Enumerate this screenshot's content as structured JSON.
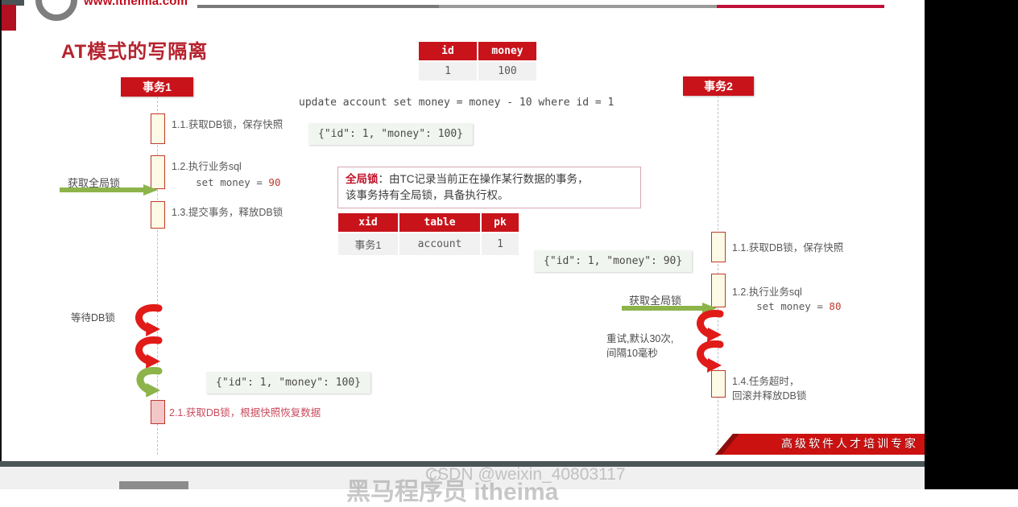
{
  "header": {
    "site_url": "www.itheima.com",
    "logo_name": "itheima-ring-logo"
  },
  "slide": {
    "title": "AT模式的写隔离",
    "sql_statement": "update account set money = money - 10 where id = 1"
  },
  "account_table": {
    "headers": [
      "id",
      "money"
    ],
    "rows": [
      [
        "1",
        "100"
      ]
    ]
  },
  "lock_table": {
    "headers": [
      "xid",
      "table",
      "pk"
    ],
    "rows": [
      [
        "事务1",
        "account",
        "1"
      ]
    ]
  },
  "note": {
    "term": "全局锁",
    "line1": "：由TC记录当前正在操作某行数据的事务，",
    "line2": "该事务持有全局锁，具备执行权。"
  },
  "tx1": {
    "actor_label": "事务1",
    "global_lock_arrow_label": "获取全局锁",
    "wait_db_lock_label": "等待DB锁",
    "steps": [
      {
        "id": "1.1",
        "text": "1.1.获取DB锁，保存快照"
      },
      {
        "id": "1.2",
        "text": "1.2.执行业务sql",
        "sub": "    set money = ",
        "sub_value": "90"
      },
      {
        "id": "1.3",
        "text": "1.3.提交事务，释放DB锁"
      },
      {
        "id": "2.1",
        "text": "2.1.获取DB锁，根据快照恢复数据"
      }
    ],
    "snapshot_json": "{\"id\": 1, \"money\": 100}",
    "restore_json": "{\"id\": 1, \"money\": 100}"
  },
  "tx2": {
    "actor_label": "事务2",
    "global_lock_arrow_label": "获取全局锁",
    "retry_label_line1": "重试,默认30次,",
    "retry_label_line2": "间隔10毫秒",
    "steps": [
      {
        "id": "1.1",
        "text": "1.1.获取DB锁，保存快照"
      },
      {
        "id": "1.2",
        "text": "1.2.执行业务sql",
        "sub": "    set money = ",
        "sub_value": "80"
      },
      {
        "id": "1.4",
        "text": "1.4.任务超时，",
        "sub2": "回滚并释放DB锁"
      }
    ],
    "snapshot_json": "{\"id\": 1, \"money\": 90}"
  },
  "ribbon": {
    "text": "高级软件人才培训专家"
  },
  "watermark": {
    "text": "CSDN @weixin_40803117",
    "brand": "黑马程序员 itheima"
  },
  "colors": {
    "brand_red": "#c9131b",
    "title_red": "#b5232e",
    "accent_green": "#8cb44a",
    "retry_red": "#e01b18",
    "lifeline": "#b9c3cc",
    "activation_fill": "#fdfbe6"
  }
}
